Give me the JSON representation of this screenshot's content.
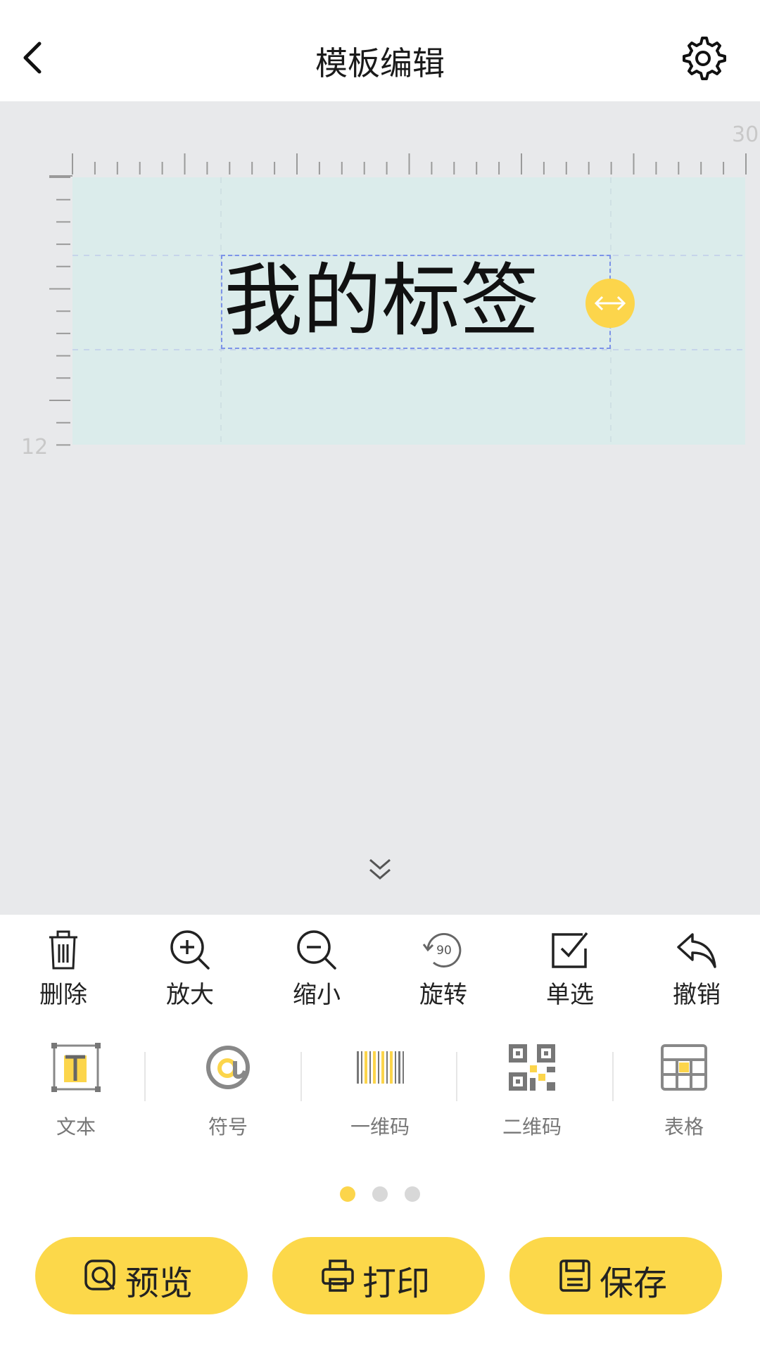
{
  "header": {
    "title": "模板编辑"
  },
  "ruler": {
    "top_max": "30",
    "left_max": "12"
  },
  "label": {
    "text": "我的标签"
  },
  "toolbar": {
    "delete": "删除",
    "zoom_in": "放大",
    "zoom_out": "缩小",
    "rotate": "旋转",
    "rotate_badge": "90",
    "single_select": "单选",
    "undo": "撤销"
  },
  "elements": {
    "text": "文本",
    "symbol": "符号",
    "barcode": "一维码",
    "qrcode": "二维码",
    "table": "表格"
  },
  "pager": {
    "current": 1,
    "total": 3
  },
  "actions": {
    "preview": "预览",
    "print": "打印",
    "save": "保存"
  },
  "colors": {
    "accent": "#fcd54b",
    "canvas": "#e8e9eb",
    "label_bg": "#dbeceb",
    "selection": "#7c93e8"
  },
  "icons": [
    "back-icon",
    "gear-icon",
    "resize-arrows-icon",
    "double-chevron-down-icon",
    "trash-icon",
    "zoom-in-icon",
    "zoom-out-icon",
    "rotate-icon",
    "checkbox-icon",
    "undo-icon",
    "text-element-icon",
    "at-symbol-icon",
    "barcode-icon",
    "qrcode-icon",
    "table-icon",
    "preview-icon",
    "printer-icon",
    "save-icon"
  ]
}
